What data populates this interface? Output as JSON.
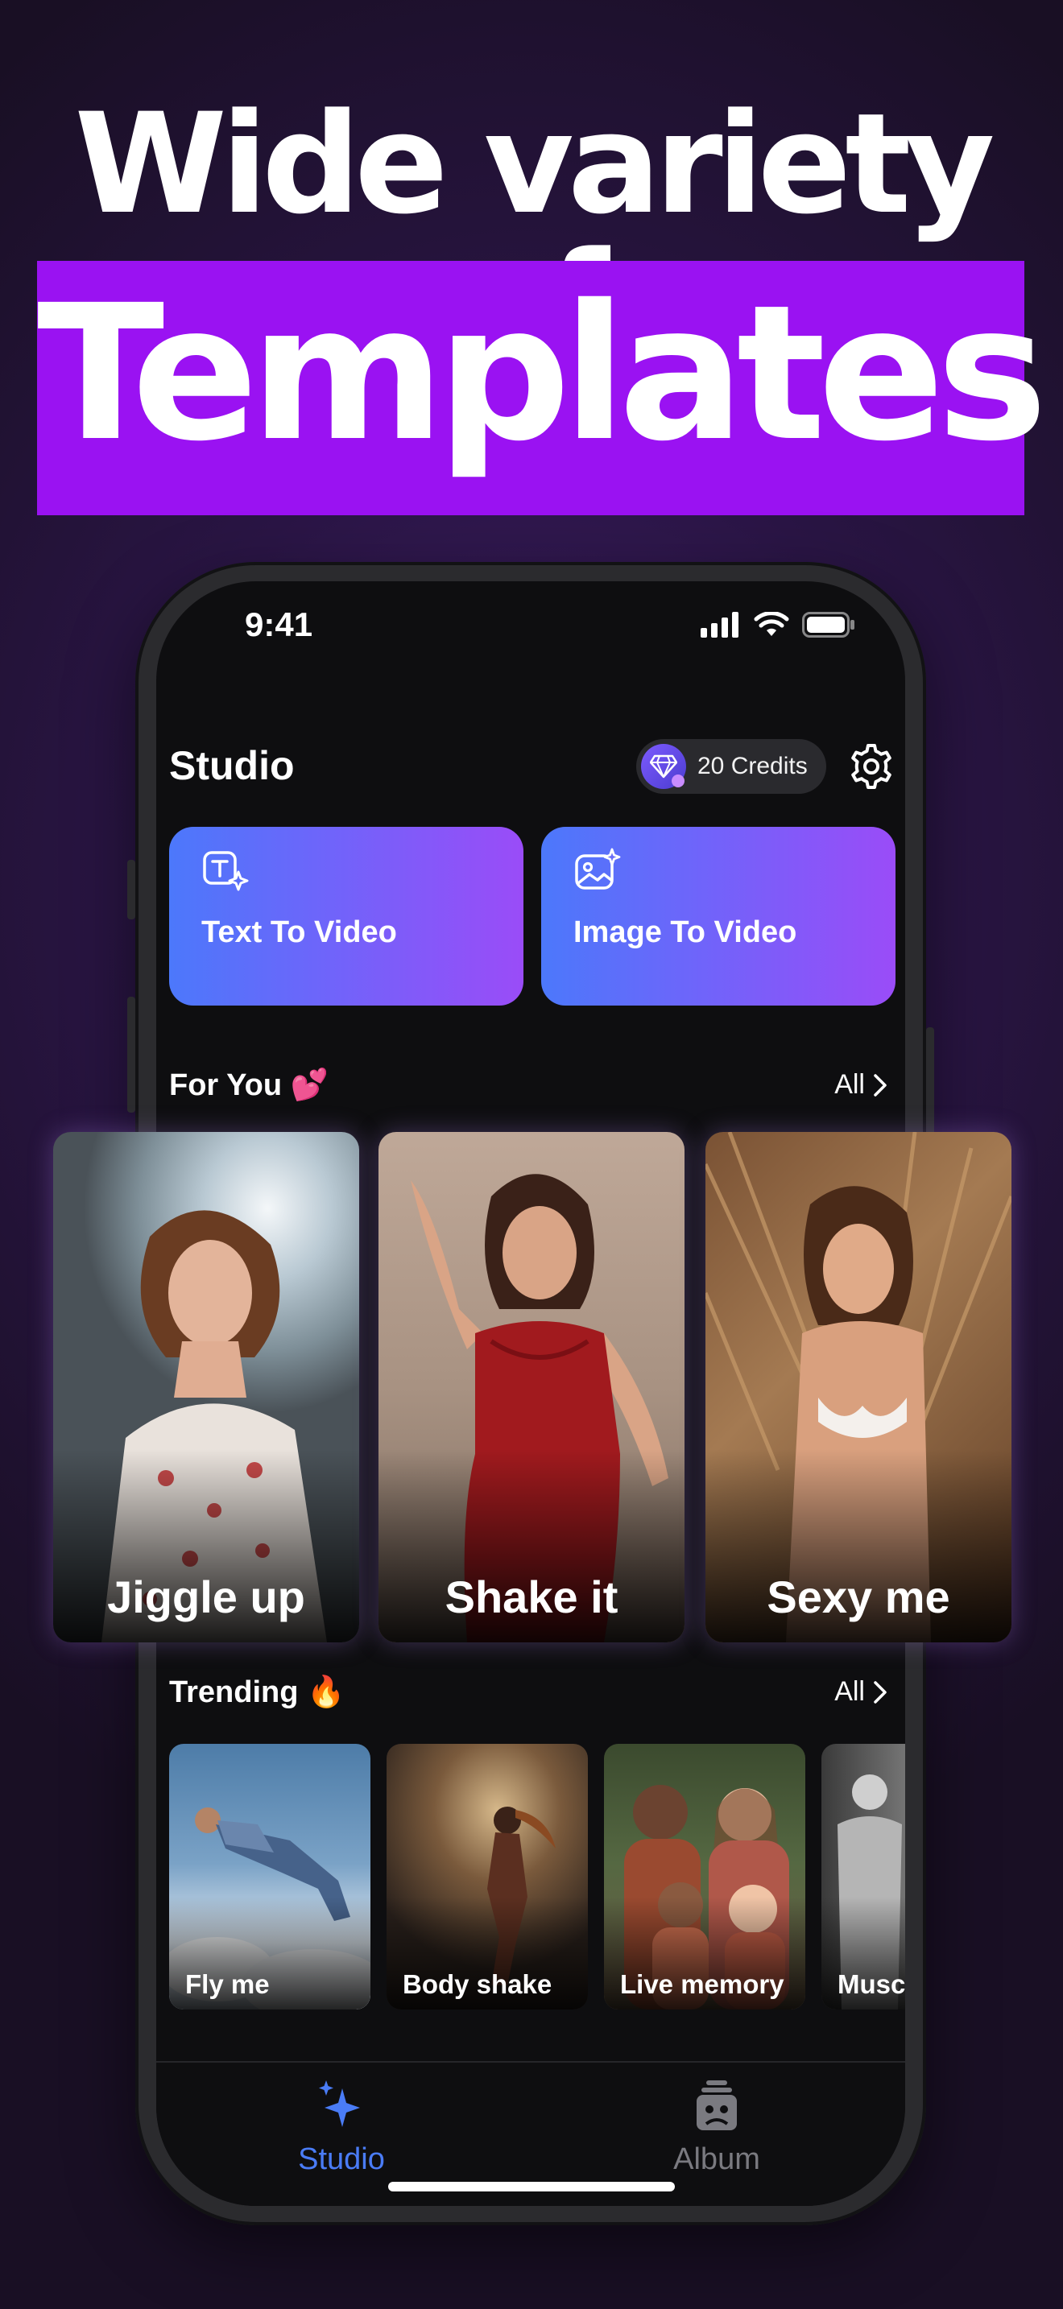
{
  "headline": {
    "line1": "Wide variety of",
    "line2": "Templates"
  },
  "status_bar": {
    "time": "9:41"
  },
  "header": {
    "title": "Studio",
    "credits_label": "20 Credits"
  },
  "features": [
    {
      "label": "Text To Video",
      "icon": "text-sparkle-icon"
    },
    {
      "label": "Image To Video",
      "icon": "image-sparkle-icon"
    }
  ],
  "for_you": {
    "title": "For You 💕",
    "all_label": "All",
    "items": [
      {
        "label": "Jiggle up"
      },
      {
        "label": "Shake it"
      },
      {
        "label": "Sexy me"
      }
    ]
  },
  "trending": {
    "title": "Trending 🔥",
    "all_label": "All",
    "items": [
      {
        "label": "Fly me"
      },
      {
        "label": "Body shake"
      },
      {
        "label": "Live memory"
      },
      {
        "label": "Musc"
      }
    ]
  },
  "tabs": [
    {
      "label": "Studio",
      "icon": "sparkles-icon",
      "active": true
    },
    {
      "label": "Album",
      "icon": "album-stack-icon",
      "active": false
    }
  ],
  "colors": {
    "headline_highlight": "#9a12f2",
    "feature_gradient_start": "#4c78fb",
    "feature_gradient_end": "#9a4cf8",
    "active_tab": "#4a7cf6",
    "inactive_tab": "#7a7a80"
  }
}
